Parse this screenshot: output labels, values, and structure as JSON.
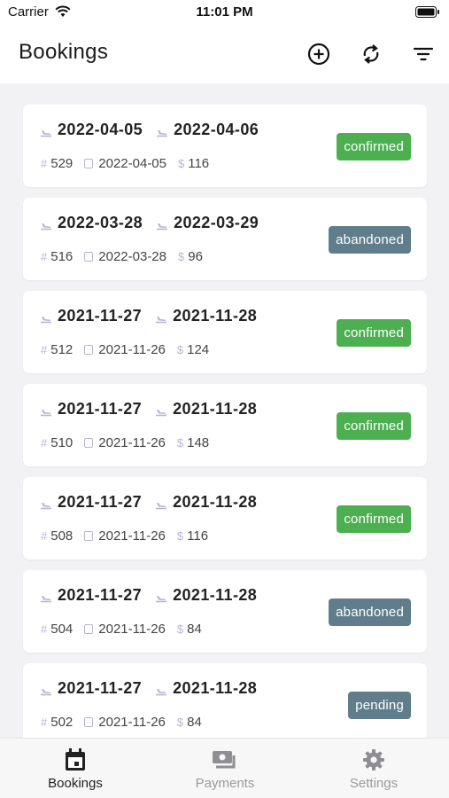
{
  "status_bar": {
    "carrier": "Carrier",
    "time": "11:01 PM"
  },
  "header": {
    "title": "Bookings",
    "actions": [
      {
        "icon": "plus-circle-icon"
      },
      {
        "icon": "refresh-icon"
      },
      {
        "icon": "filter-icon"
      }
    ]
  },
  "colors": {
    "confirmed": "#4caf50",
    "abandoned": "#607d8b",
    "pending": "#607d8b",
    "icon_muted": "#b9b5d2"
  },
  "bookings": [
    {
      "departure": "2022-04-05",
      "return": "2022-04-06",
      "id": "529",
      "booked_on": "2022-04-05",
      "price": "116",
      "status": "confirmed"
    },
    {
      "departure": "2022-03-28",
      "return": "2022-03-29",
      "id": "516",
      "booked_on": "2022-03-28",
      "price": "96",
      "status": "abandoned"
    },
    {
      "departure": "2021-11-27",
      "return": "2021-11-28",
      "id": "512",
      "booked_on": "2021-11-26",
      "price": "124",
      "status": "confirmed"
    },
    {
      "departure": "2021-11-27",
      "return": "2021-11-28",
      "id": "510",
      "booked_on": "2021-11-26",
      "price": "148",
      "status": "confirmed"
    },
    {
      "departure": "2021-11-27",
      "return": "2021-11-28",
      "id": "508",
      "booked_on": "2021-11-26",
      "price": "116",
      "status": "confirmed"
    },
    {
      "departure": "2021-11-27",
      "return": "2021-11-28",
      "id": "504",
      "booked_on": "2021-11-26",
      "price": "84",
      "status": "abandoned"
    },
    {
      "departure": "2021-11-27",
      "return": "2021-11-28",
      "id": "502",
      "booked_on": "2021-11-26",
      "price": "84",
      "status": "pending"
    }
  ],
  "tabs": [
    {
      "label": "Bookings",
      "icon": "calendar-icon",
      "active": true
    },
    {
      "label": "Payments",
      "icon": "payments-icon",
      "active": false
    },
    {
      "label": "Settings",
      "icon": "gear-icon",
      "active": false
    }
  ]
}
